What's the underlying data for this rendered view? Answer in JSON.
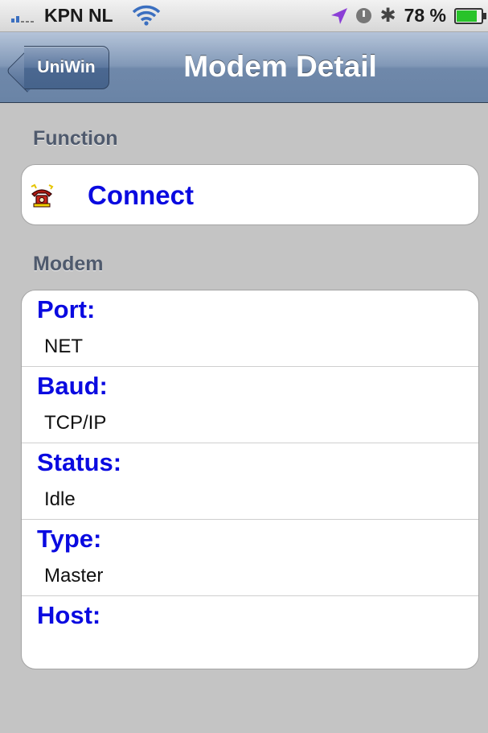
{
  "status_bar": {
    "carrier": "KPN NL",
    "battery_percent": "78 %",
    "battery_level": 0.78,
    "icons": [
      "signal-icon",
      "wifi-icon",
      "location-icon",
      "alarm-icon",
      "bluetooth-icon",
      "battery-charging-icon"
    ]
  },
  "nav": {
    "back_label": "UniWin",
    "title": "Modem Detail",
    "bar_color": "#6f88aa"
  },
  "function_section": {
    "header": "Function",
    "connect_label": "Connect",
    "connect_icon": "telephone-icon"
  },
  "modem_section": {
    "header": "Modem",
    "fields": [
      {
        "label": "Port:",
        "value": "NET"
      },
      {
        "label": "Baud:",
        "value": "TCP/IP"
      },
      {
        "label": "Status:",
        "value": "Idle"
      },
      {
        "label": "Type:",
        "value": "Master"
      },
      {
        "label": "Host:",
        "value": ""
      }
    ]
  },
  "colors": {
    "accent_text": "#0a0ae0",
    "section_header": "#4f5a6d",
    "background": "#c4c4c4"
  }
}
